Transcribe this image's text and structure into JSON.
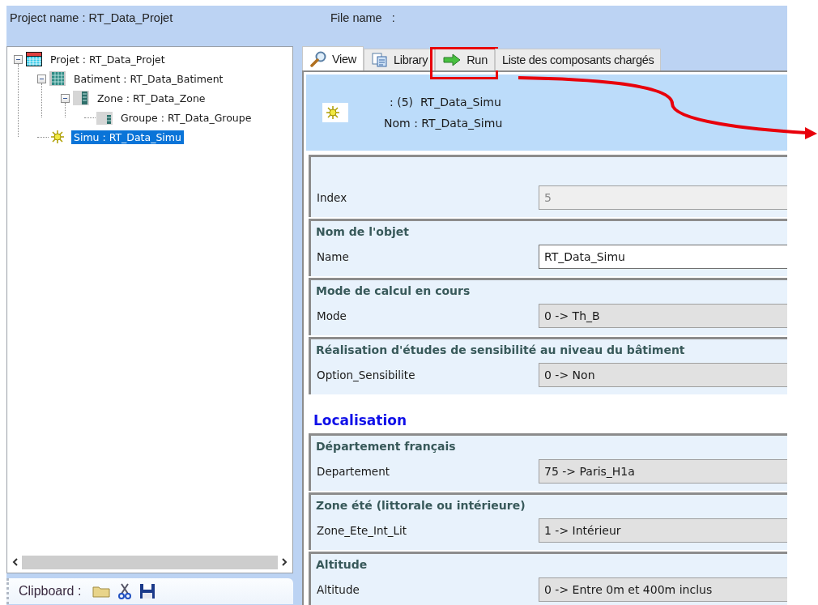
{
  "header": {
    "project_name": "Project name : RT_Data_Projet",
    "file_name": "File name   :"
  },
  "tree": [
    {
      "label": "Projet : RT_Data_Projet",
      "kind": "projet",
      "expanded": true,
      "selected": false,
      "children": [
        {
          "label": "Batiment : RT_Data_Batiment",
          "kind": "batiment",
          "expanded": true,
          "selected": false,
          "children": [
            {
              "label": "Zone : RT_Data_Zone",
              "kind": "zone",
              "expanded": true,
              "selected": false,
              "children": [
                {
                  "label": "Groupe : RT_Data_Groupe",
                  "kind": "groupe",
                  "selected": false
                }
              ]
            }
          ]
        },
        {
          "label": "Simu : RT_Data_Simu",
          "kind": "simu",
          "selected": true
        }
      ]
    }
  ],
  "clipboard": {
    "label": "Clipboard :"
  },
  "tabs": [
    {
      "label": "View",
      "kind": "magnifier",
      "selected": true,
      "highlighted": false
    },
    {
      "label": "Library",
      "kind": "documents",
      "selected": false,
      "highlighted": false
    },
    {
      "label": "Run",
      "kind": "arrow",
      "selected": false,
      "highlighted": true
    },
    {
      "label": "Liste des composants chargés",
      "selected": false,
      "highlighted": false
    }
  ],
  "object": {
    "line_1": ": (5)  RT_Data_Simu",
    "line_2": "Nom : RT_Data_Simu"
  },
  "form": [
    {
      "kind": "group",
      "field": {
        "label": "Index",
        "value": "5",
        "kind": "disabled"
      }
    },
    {
      "kind": "group",
      "title": "Nom de l'objet",
      "field": {
        "label": "Name",
        "value": "RT_Data_Simu",
        "kind": "text"
      }
    },
    {
      "kind": "group",
      "title": "Mode de calcul en cours",
      "field": {
        "label": "Mode",
        "value": "0 -> Th_B",
        "kind": "choice"
      }
    },
    {
      "kind": "group",
      "title": "Réalisation d'études de sensibilité au niveau du bâtiment",
      "field": {
        "label": "Option_Sensibilite",
        "value": "0 -> Non",
        "kind": "choice"
      }
    },
    {
      "kind": "heading",
      "title": "Localisation"
    },
    {
      "kind": "group",
      "title": "Département français",
      "field": {
        "label": "Departement",
        "value": "75 -> Paris_H1a",
        "kind": "choice"
      }
    },
    {
      "kind": "group",
      "title": "Zone été (littorale ou intérieure)",
      "field": {
        "label": "Zone_Ete_Int_Lit",
        "value": "1 -> Intérieur",
        "kind": "choice"
      }
    },
    {
      "kind": "group",
      "title": "Altitude",
      "field": {
        "label": "Altitude",
        "value": "0 -> Entre 0m et 400m inclus",
        "kind": "choice"
      }
    }
  ]
}
